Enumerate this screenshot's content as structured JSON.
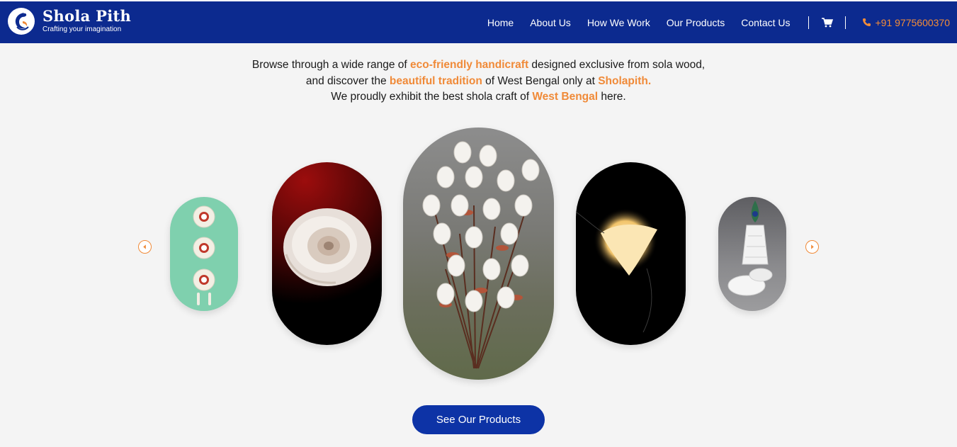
{
  "header": {
    "brand_name": "Shola Pith",
    "brand_tagline": "Crafting your imagination",
    "nav": [
      {
        "label": "Home"
      },
      {
        "label": "About Us"
      },
      {
        "label": "How We Work"
      },
      {
        "label": "Our Products"
      },
      {
        "label": "Contact Us"
      }
    ],
    "phone": "+91 9775600370",
    "icons": {
      "logo": "peacock-logo-icon",
      "cart": "cart-icon",
      "phone": "phone-icon"
    }
  },
  "intro": {
    "line1": {
      "a": "Browse through a wide range of ",
      "b": "eco-friendly handicraft",
      "c": " designed exclusive from sola wood,"
    },
    "line2": {
      "a": "and discover the ",
      "b": "beautiful tradition",
      "c": " of West Bengal only at ",
      "d": "Sholapith."
    },
    "line3": {
      "a": "We proudly exhibit the best shola craft of ",
      "b": "West Bengal",
      "c": " here."
    }
  },
  "carousel": {
    "prev_icon": "arrow-left-icon",
    "next_icon": "arrow-right-icon",
    "slide_count": 5
  },
  "cta": {
    "label": "See Our Products"
  },
  "colors": {
    "header_bg": "#0c2a8f",
    "accent": "#f08a38",
    "button_bg": "#0d33a6",
    "page_bg": "#f4f4f4"
  }
}
